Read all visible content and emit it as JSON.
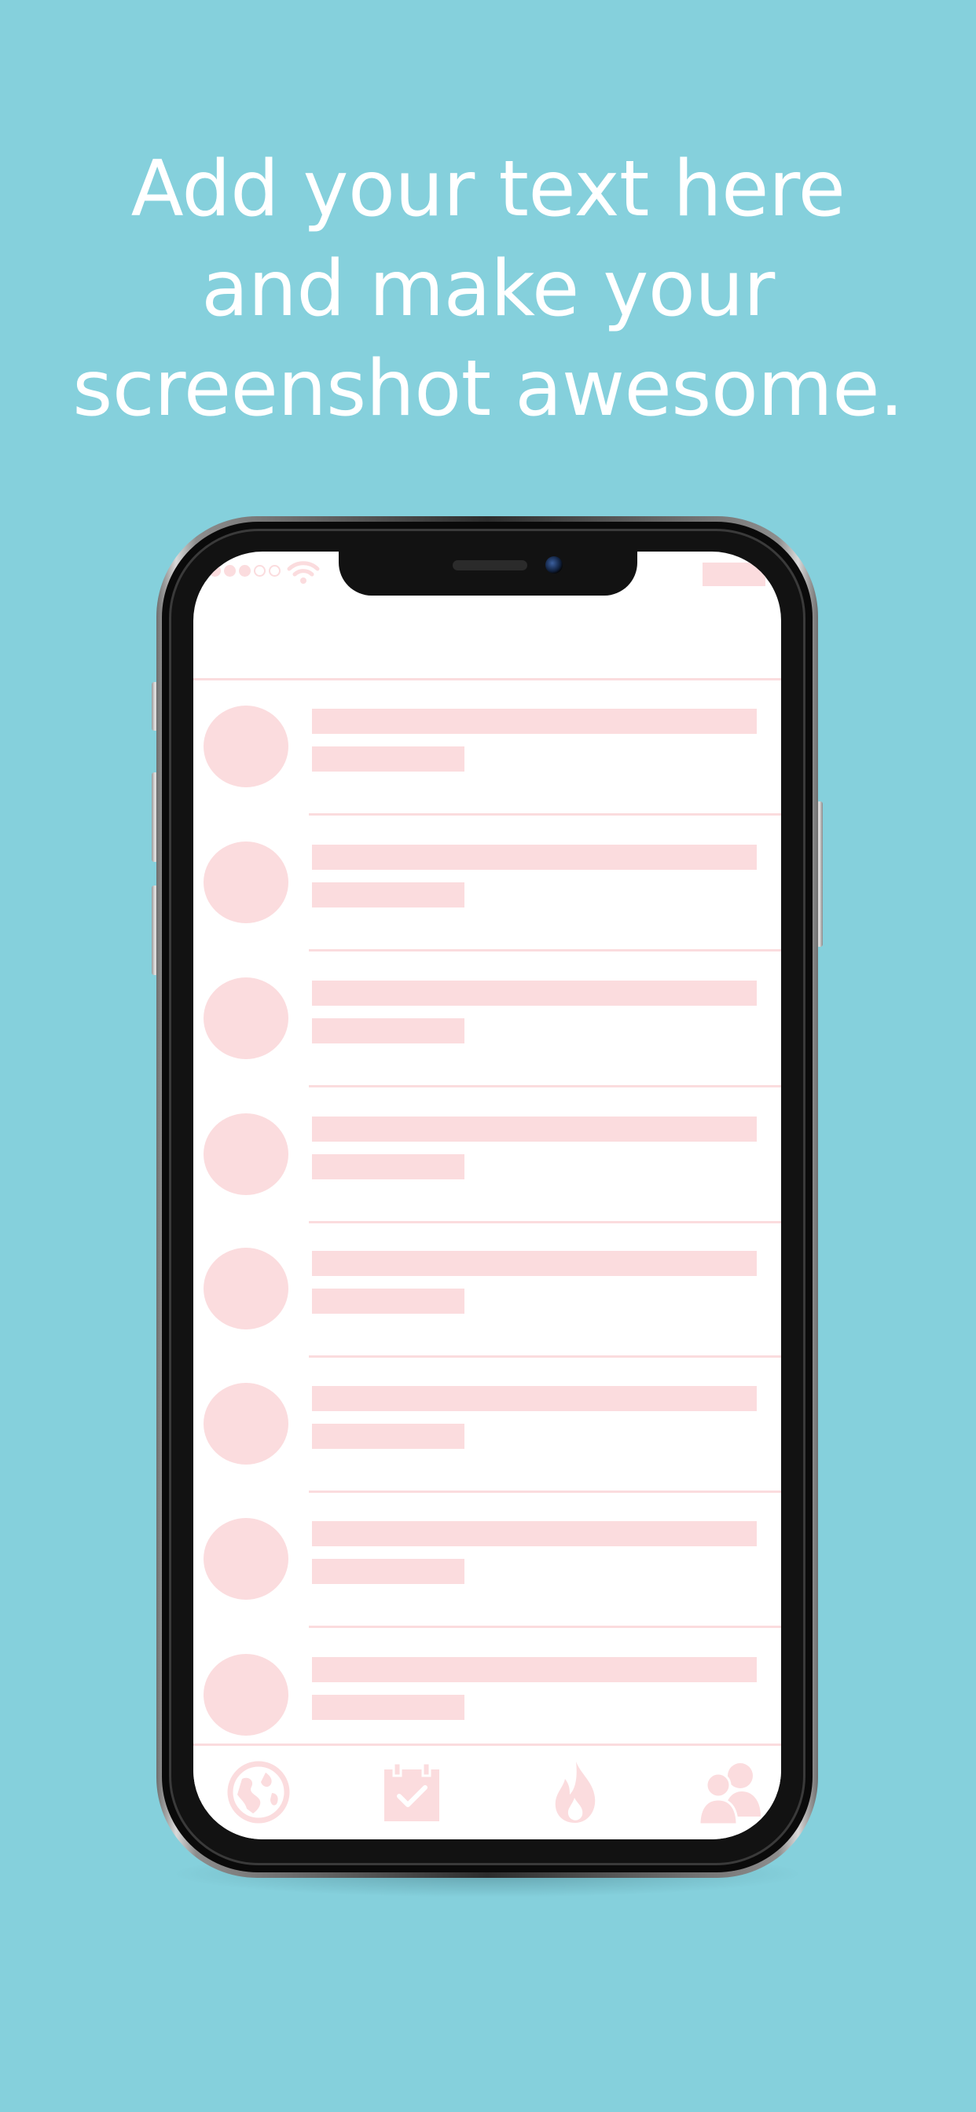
{
  "headline": "Add your text here and make your screenshot awesome.",
  "colors": {
    "background": "#85d0dc",
    "placeholder": "#fbdcde",
    "screen": "#ffffff",
    "headline_text": "#ffffff"
  },
  "status_bar": {
    "signal_icon": "signal-dots-icon",
    "wifi_icon": "wifi-icon",
    "battery_icon": "battery-icon"
  },
  "list": {
    "row_count": 8,
    "row_content": "placeholder"
  },
  "tab_bar": {
    "tabs": [
      {
        "icon": "globe-icon"
      },
      {
        "icon": "calendar-check-icon"
      },
      {
        "icon": "flame-icon"
      },
      {
        "icon": "users-icon"
      }
    ]
  }
}
